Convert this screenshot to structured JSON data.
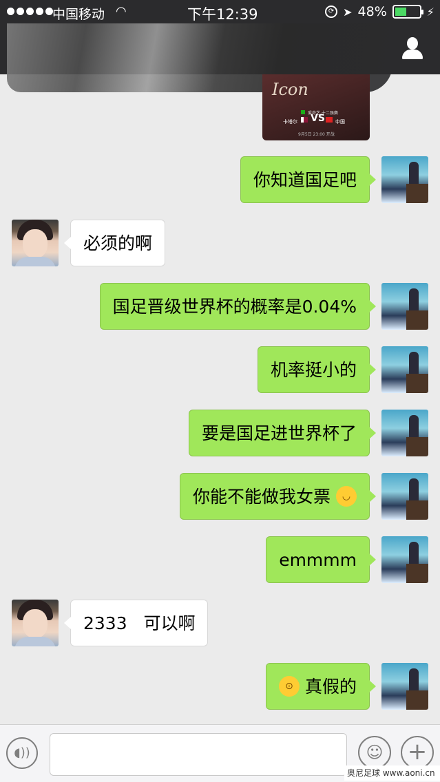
{
  "status_bar": {
    "carrier": "中国移动",
    "time": "下午12:39",
    "battery": "48%",
    "battery_level": 0.48
  },
  "share_card": {
    "title": "Icon",
    "header": "爱奇艺 十二强赛",
    "team_left": "卡塔尔",
    "vs": "VS",
    "team_right": "中国",
    "date": "9月5日 23:00 开战"
  },
  "messages": [
    {
      "side": "me",
      "text": "你知道国足吧"
    },
    {
      "side": "them",
      "text": "必须的啊"
    },
    {
      "side": "me",
      "text": "国足晋级世界杯的概率是0.04%"
    },
    {
      "side": "me",
      "text": "机率挺小的"
    },
    {
      "side": "me",
      "text": "要是国足进世界杯了"
    },
    {
      "side": "me",
      "text": "你能不能做我女票",
      "emoji": "blushing-face"
    },
    {
      "side": "me",
      "text": "emmmm"
    },
    {
      "side": "them",
      "text": "2333   可以啊"
    },
    {
      "side": "me",
      "text": "真假的",
      "emoji": "flushed-face"
    }
  ],
  "input_bar": {
    "placeholder": "",
    "plus": "+"
  },
  "watermark": "奥尼足球 www.aoni.cn"
}
